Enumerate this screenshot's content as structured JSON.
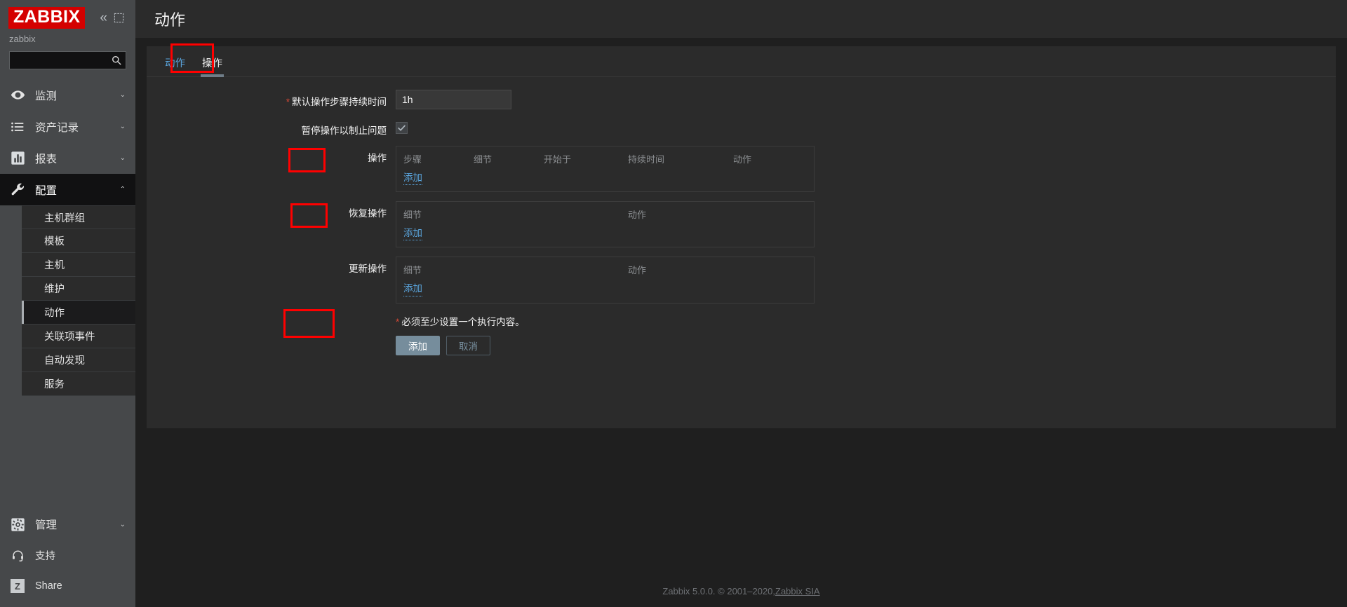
{
  "sidebar": {
    "logo_text": "ZABBIX",
    "collapse_icon": "chevron-double-left-icon",
    "expand_icon": "expand-icon",
    "server_name": "zabbix",
    "search": {
      "value": "",
      "placeholder": ""
    },
    "items": [
      {
        "label": "监测",
        "icon": "eye-icon",
        "caret": "⌄"
      },
      {
        "label": "资产记录",
        "icon": "list-icon",
        "caret": "⌄"
      },
      {
        "label": "报表",
        "icon": "bar-chart-icon",
        "caret": "⌄"
      },
      {
        "label": "配置",
        "icon": "wrench-icon",
        "caret": "⌃"
      }
    ],
    "submenu": [
      {
        "label": "主机群组"
      },
      {
        "label": "模板"
      },
      {
        "label": "主机"
      },
      {
        "label": "维护"
      },
      {
        "label": "动作"
      },
      {
        "label": "关联项事件"
      },
      {
        "label": "自动发现"
      },
      {
        "label": "服务"
      }
    ],
    "bottom_items": [
      {
        "label": "管理",
        "icon": "gear-icon",
        "caret": "⌄"
      },
      {
        "label": "支持",
        "icon": "headset-icon"
      },
      {
        "label": "Share",
        "icon": "zabbix-z-icon"
      }
    ]
  },
  "header": {
    "title": "动作"
  },
  "tabs": [
    {
      "label": "动作",
      "active": false
    },
    {
      "label": "操作",
      "active": true
    }
  ],
  "form": {
    "duration": {
      "label": "默认操作步骤持续时间",
      "required": true,
      "value": "1h",
      "placeholder": ""
    },
    "pause": {
      "label": "暂停操作以制止问题",
      "checked": true
    },
    "operations": {
      "label": "操作",
      "columns": [
        "步骤",
        "细节",
        "开始于",
        "持续时间",
        "动作"
      ],
      "rows": [],
      "add_label": "添加"
    },
    "recovery_operations": {
      "label": "恢复操作",
      "columns": [
        "细节",
        "动作"
      ],
      "rows": [],
      "add_label": "添加"
    },
    "update_operations": {
      "label": "更新操作",
      "columns": [
        "细节",
        "动作"
      ],
      "rows": [],
      "add_label": "添加"
    },
    "note": "必须至少设置一个执行内容。",
    "note_required_mark": "*",
    "submit_label": "添加",
    "cancel_label": "取消"
  },
  "footer": {
    "text": "Zabbix 5.0.0. © 2001–2020, ",
    "link": "Zabbix SIA"
  },
  "colors": {
    "brand_red": "#d40000",
    "link_blue": "#5ba7e0",
    "annotation_red": "#ff0000",
    "primary_button": "#768d9c",
    "required_asterisk": "#d34836"
  }
}
